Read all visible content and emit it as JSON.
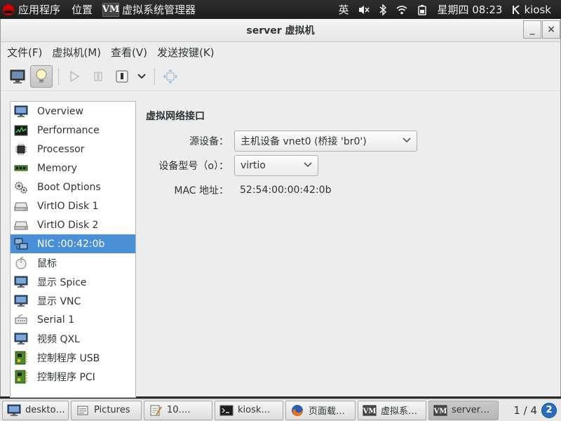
{
  "top_panel": {
    "apps_label": "应用程序",
    "places_label": "位置",
    "active_app_label": "虚拟系统管理器",
    "input_method": "英",
    "clock": "星期四 08:23",
    "user": "kiosk"
  },
  "window": {
    "title": "server 虚拟机",
    "minimize": "_",
    "close": "×"
  },
  "menubar": {
    "file": "文件(F)",
    "vm": "虚拟机(M)",
    "view": "查看(V)",
    "send_key": "发送按键(K)"
  },
  "sidebar": {
    "items": [
      {
        "label": "Overview",
        "icon": "monitor-icon"
      },
      {
        "label": "Performance",
        "icon": "performance-icon"
      },
      {
        "label": "Processor",
        "icon": "chip-icon"
      },
      {
        "label": "Memory",
        "icon": "memory-icon"
      },
      {
        "label": "Boot Options",
        "icon": "gears-icon"
      },
      {
        "label": "VirtIO Disk 1",
        "icon": "disk-icon"
      },
      {
        "label": "VirtIO Disk 2",
        "icon": "disk-icon"
      },
      {
        "label": "NIC :00:42:0b",
        "icon": "network-icon"
      },
      {
        "label": "鼠标",
        "icon": "mouse-icon"
      },
      {
        "label": "显示  Spice",
        "icon": "monitor-icon"
      },
      {
        "label": "显示  VNC",
        "icon": "monitor-icon"
      },
      {
        "label": "Serial 1",
        "icon": "serial-icon"
      },
      {
        "label": "视频  QXL",
        "icon": "monitor-icon"
      },
      {
        "label": "控制程序  USB",
        "icon": "controller-icon"
      },
      {
        "label": "控制程序  PCI",
        "icon": "controller-icon"
      }
    ],
    "selected_index": 7
  },
  "details": {
    "section_title": "虚拟网络接口",
    "source_label": "源设备：",
    "source_value": "主机设备  vnet0 (桥接  'br0')",
    "model_label": "设备型号（o）：",
    "model_value": "virtio",
    "mac_label": "MAC 地址：",
    "mac_value": "52:54:00:00:42:0b"
  },
  "taskbar": {
    "tasks": [
      {
        "label": "deskto…",
        "icon": "monitor-icon"
      },
      {
        "label": "Pictures",
        "icon": "folder-icon"
      },
      {
        "label": "10….",
        "icon": "text-editor-icon"
      },
      {
        "label": "kiosk…",
        "icon": "terminal-icon"
      },
      {
        "label": "页面载…",
        "icon": "firefox-icon"
      },
      {
        "label": "虚拟系…",
        "icon": "virt-manager-icon"
      },
      {
        "label": "server…",
        "icon": "virt-manager-icon"
      }
    ],
    "pager": "1 / 4",
    "notifications": "2"
  }
}
